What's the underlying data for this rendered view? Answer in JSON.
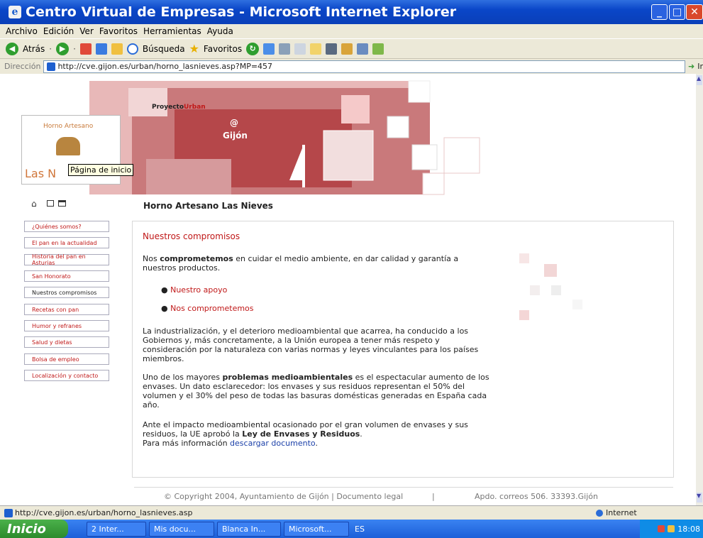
{
  "window": {
    "title": "Centro Virtual de Empresas - Microsoft Internet Explorer"
  },
  "menu": [
    "Archivo",
    "Edición",
    "Ver",
    "Favoritos",
    "Herramientas",
    "Ayuda"
  ],
  "toolbar": {
    "back": "Atrás",
    "search": "Búsqueda",
    "favorites": "Favoritos"
  },
  "address": {
    "label": "Dirección",
    "url": "http://cve.gijon.es/urban/horno_lasnieves.asp?MP=457",
    "go": "Ir"
  },
  "banner": {
    "proyecto": "Proyecto",
    "urban": "Urban",
    "gijon": "Gijón",
    "at": "@"
  },
  "logo": {
    "arc": "Horno Artesano",
    "name": "Las N"
  },
  "tooltip": "Página de inicio",
  "page": {
    "title": "Horno Artesano Las Nieves"
  },
  "nav": [
    "¿Quiénes somos?",
    "El pan en la actualidad",
    "Historia del pan en Asturias",
    "San Honorato",
    "Nuestros compromisos",
    "Recetas con pan",
    "Humor y refranes",
    "Salud y dietas",
    "Bolsa de empleo",
    "Localización y contacto"
  ],
  "content": {
    "heading": "Nuestros compromisos",
    "p1a": "Nos ",
    "p1b": "comprometemos",
    "p1c": " en cuidar el medio ambiente, en dar calidad y garantía a nuestros productos.",
    "links": [
      "Nuestro apoyo",
      "Nos comprometemos"
    ],
    "p2": "La industrialización, y el deterioro medioambiental que acarrea, ha conducido a los Gobiernos y, más concretamente, a la Unión europea a tener más respeto y consideración por la naturaleza con varias normas y leyes vinculantes para los países miembros.",
    "p3a": "Uno de los mayores ",
    "p3b": "problemas medioambientales",
    "p3c": " es el espectacular aumento de los envases. Un dato esclarecedor: los envases y sus residuos representan el 50% del volumen y el 30% del peso de todas las basuras domésticas generadas en España cada año.",
    "p4a": "Ante el impacto medioambiental ocasionado por el gran volumen de envases y sus residuos, la UE aprobó la ",
    "p4b": "Ley de Envases y Residuos",
    "p4c": ".",
    "p5a": "Para más información ",
    "p5b": "descargar documento",
    "p5c": "."
  },
  "footer": {
    "copyright": "© Copyright 2004, Ayuntamiento de Gijón | Documento legal",
    "sep": "|",
    "address": "Apdo. correos 506. 33393.Gijón"
  },
  "status": {
    "url": "http://cve.gijon.es/urban/horno_lasnieves.asp",
    "zone": "Internet"
  },
  "taskbar": {
    "start": "Inicio",
    "tasks": [
      "2 Inter...",
      "Mis docu...",
      "Blanca In...",
      "Microsoft..."
    ],
    "lang": "ES",
    "time": "18:08"
  },
  "colors": {
    "accent": "#c01818",
    "xp_blue": "#0a46c8"
  }
}
